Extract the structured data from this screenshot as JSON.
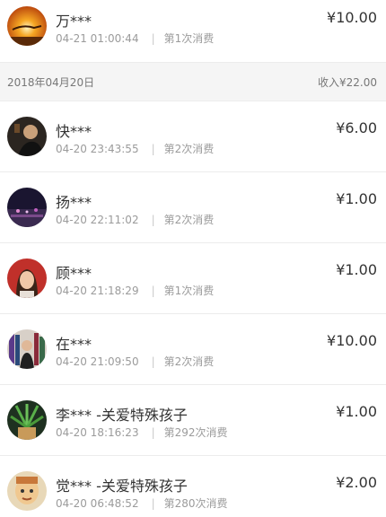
{
  "transactions_top": [
    {
      "name": "万***",
      "amount": "¥10.00",
      "time": "04-21 01:00:44",
      "sep": "|",
      "count": "第1次消费",
      "avatar": "sunset-avatar"
    }
  ],
  "day_group": {
    "date": "2018年04月20日",
    "income": "收入¥22.00"
  },
  "transactions": [
    {
      "name": "快***",
      "amount": "¥6.00",
      "time": "04-20 23:43:55",
      "sep": "|",
      "count": "第2次消费",
      "avatar": "dark-portrait-avatar"
    },
    {
      "name": "扬***",
      "amount": "¥1.00",
      "time": "04-20 22:11:02",
      "sep": "|",
      "count": "第2次消费",
      "avatar": "night-city-avatar"
    },
    {
      "name": "顾***",
      "amount": "¥1.00",
      "time": "04-20 21:18:29",
      "sep": "|",
      "count": "第1次消费",
      "avatar": "woman-portrait-avatar"
    },
    {
      "name": "在***",
      "amount": "¥10.00",
      "time": "04-20 21:09:50",
      "sep": "|",
      "count": "第2次消费",
      "avatar": "bookshelf-avatar"
    },
    {
      "name": "李*** -关爱特殊孩子",
      "amount": "¥1.00",
      "time": "04-20 18:16:23",
      "sep": "|",
      "count": "第292次消费",
      "avatar": "plant-avatar"
    },
    {
      "name": "觉*** -关爱特殊孩子",
      "amount": "¥2.00",
      "time": "04-20 06:48:52",
      "sep": "|",
      "count": "第280次消费",
      "avatar": "cartoon-avatar"
    }
  ]
}
